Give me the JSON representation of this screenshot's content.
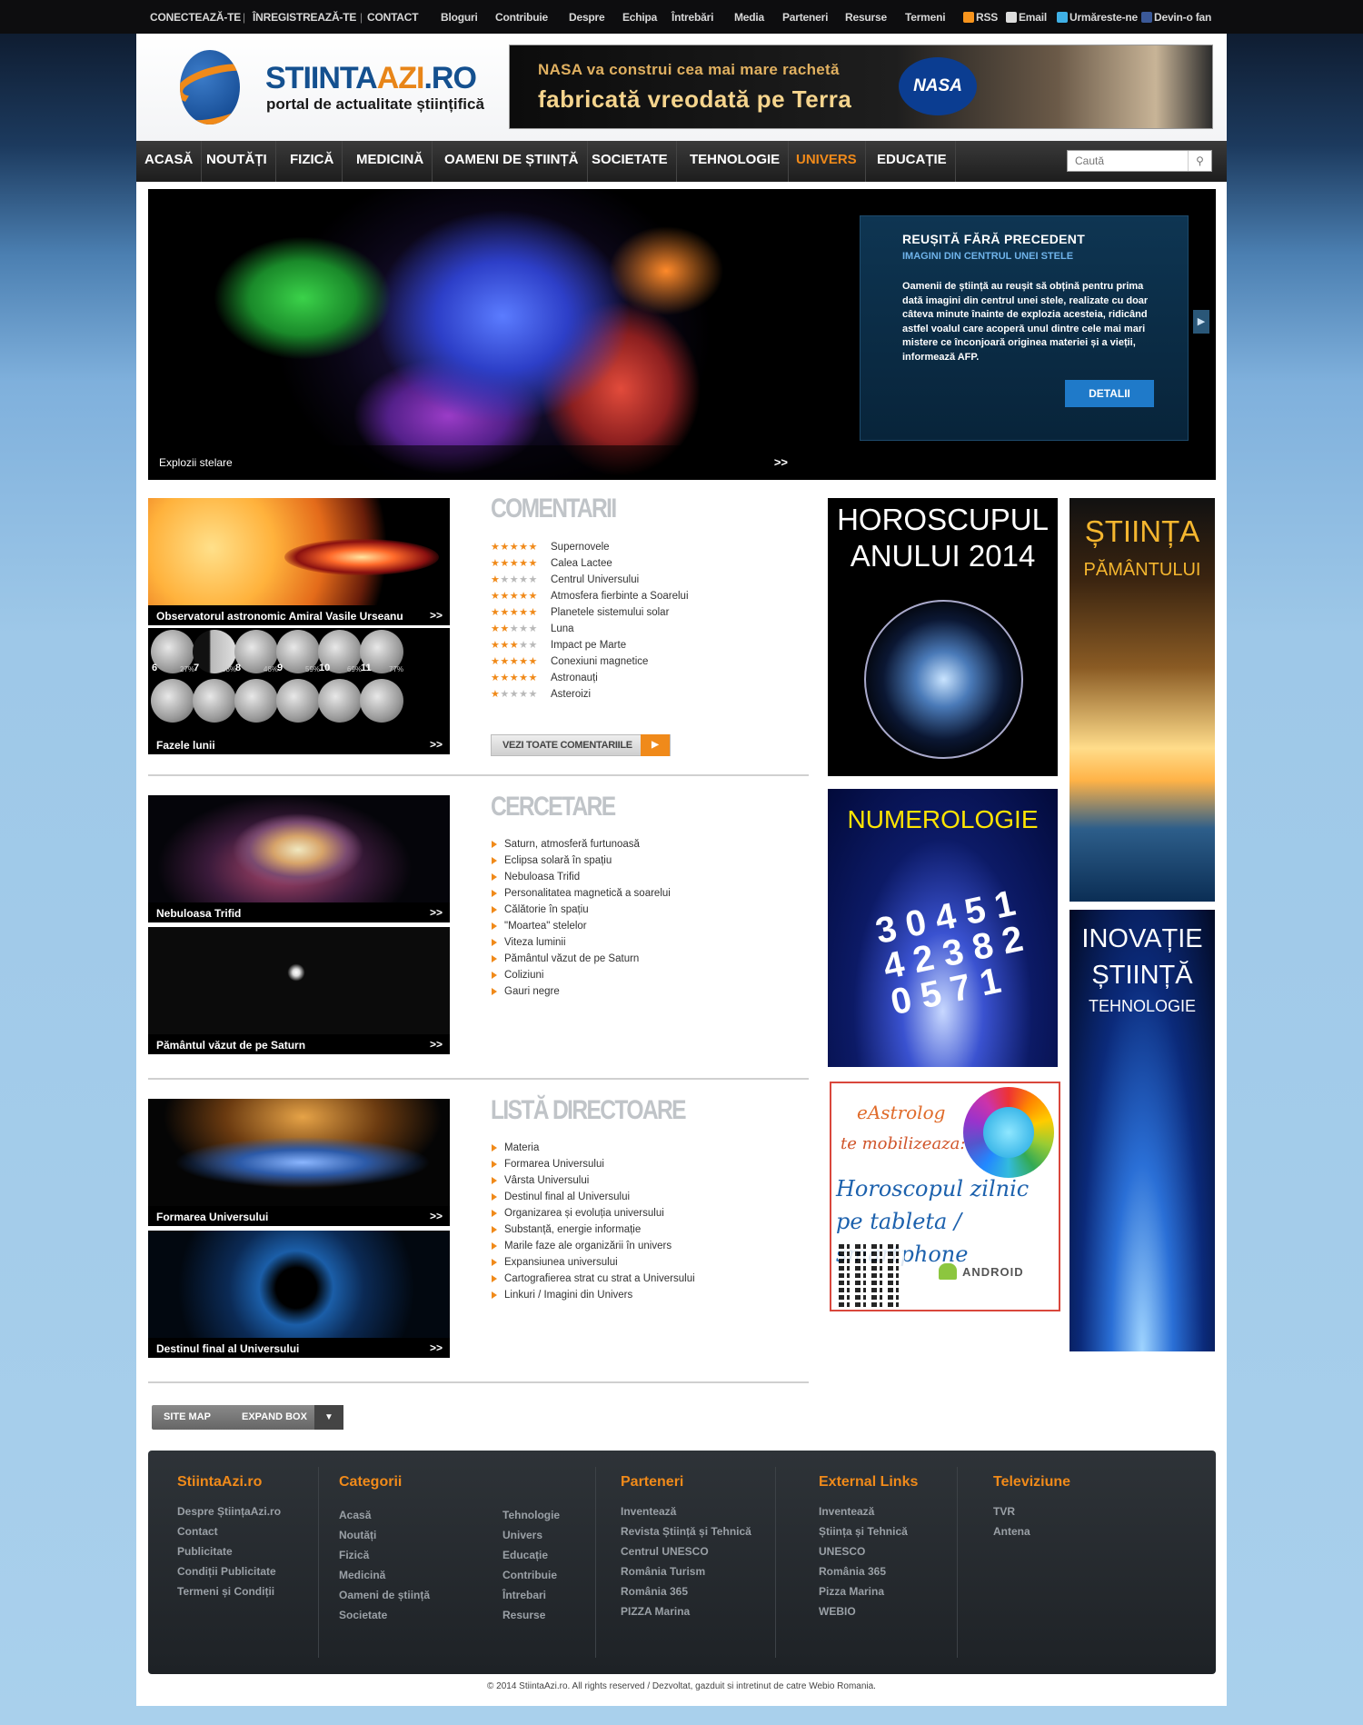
{
  "topbar": {
    "connect": "CONECTEAZĂ-TE",
    "register": "ÎNREGISTREAZĂ-TE",
    "contact": "CONTACT",
    "links": [
      "Bloguri",
      "Contribuie",
      "Despre",
      "Echipa",
      "Întrebări",
      "Media",
      "Parteneri",
      "Resurse",
      "Termeni"
    ],
    "rss": "RSS",
    "email": "Email",
    "follow": "Urmăreste-ne",
    "fan": "Devin-o fan"
  },
  "brand": {
    "name_a": "STIINTA",
    "name_b": "AZI",
    "name_c": ".RO",
    "tagline": "portal de actualitate științifică"
  },
  "banner": {
    "line1": "NASA va construi cea mai mare rachetă",
    "line2": "fabricată vreodată pe Terra",
    "badge": "NASA"
  },
  "nav": {
    "items": [
      "ACASĂ",
      "NOUTĂȚI",
      "FIZICĂ",
      "MEDICINĂ",
      "OAMENI DE ȘTIINȚĂ",
      "SOCIETATE",
      "TEHNOLOGIE",
      "UNIVERS",
      "EDUCAȚIE"
    ],
    "active": "UNIVERS",
    "search_placeholder": "Caută",
    "search_icon": "search-icon"
  },
  "slider": {
    "caption": "Explozii stelare",
    "more": ">>",
    "title": "REUȘITĂ FĂRĂ PRECEDENT",
    "subtitle": "IMAGINI DIN CENTRUL UNEI STELE",
    "text": "Oamenii de știință au reușit să obțină pentru prima dată imagini din centrul unei stele, realizate cu doar câteva minute înainte de explozia acesteia, ridicând astfel voalul care acoperă unul dintre cele mai mari mistere ce înconjoară originea materiei și a vieții, informează AFP.",
    "button": "DETALII",
    "prev": "◀",
    "next": "▶"
  },
  "thumbs": {
    "observatory": "Observatorul astronomic Amiral Vasile Urseanu",
    "moon": "Fazele lunii",
    "trifid": "Nebuloasa Trifid",
    "saturn": "Pământul văzut de pe Saturn",
    "formation": "Formarea Universului",
    "destiny": "Destinul final al Universului",
    "more": ">>"
  },
  "moon_phases": [
    {
      "day": "6",
      "pct": "27%"
    },
    {
      "day": "7",
      "pct": "38%"
    },
    {
      "day": "8",
      "pct": "48%"
    },
    {
      "day": "9",
      "pct": "59%"
    },
    {
      "day": "10",
      "pct": "69%"
    },
    {
      "day": "11",
      "pct": "77%"
    }
  ],
  "comments": {
    "heading": "COMENTARII",
    "button": "VEZI TOATE COMENTARIILE",
    "button_icon": "play-icon",
    "items": [
      {
        "label": "Supernovele",
        "stars": 5
      },
      {
        "label": "Calea Lactee",
        "stars": 5
      },
      {
        "label": "Centrul Universului",
        "stars": 1
      },
      {
        "label": "Atmosfera fierbinte a Soarelui",
        "stars": 5
      },
      {
        "label": "Planetele sistemului solar",
        "stars": 5
      },
      {
        "label": "Luna",
        "stars": 2
      },
      {
        "label": "Impact pe Marte",
        "stars": 3
      },
      {
        "label": "Conexiuni magnetice",
        "stars": 5
      },
      {
        "label": "Astronauți",
        "stars": 5
      },
      {
        "label": "Asteroizi",
        "stars": 1
      }
    ]
  },
  "research": {
    "heading": "CERCETARE",
    "items": [
      "Saturn, atmosferă furtunoasă",
      "Eclipsa solară în spațiu",
      "Nebuloasa Trifid",
      "Personalitatea magnetică a soarelui",
      "Călătorie în spațiu",
      "\"Moartea\" stelelor",
      "Viteza luminii",
      "Pământul văzut de pe Saturn",
      "Coliziuni",
      "Gauri negre"
    ]
  },
  "directory": {
    "heading": "LISTĂ DIRECTOARE",
    "items": [
      "Materia",
      "Formarea Universului",
      "Vârsta Universului",
      "Destinul final al Universului",
      "Organizarea și evoluția universului",
      "Substanță, energie informație",
      "Marile faze ale organizării în univers",
      "Expansiunea universului",
      "Cartografierea strat cu strat a Universului",
      "Linkuri / Imagini din Univers"
    ]
  },
  "ads": {
    "horo_1": "HOROSCUPUL",
    "horo_2": "ANULUI 2014",
    "numer": "NUMEROLOGIE",
    "numer_digits": "3 0 4 5 1 4 2 3 8 2 0 5 7 1",
    "astro_1": "eAstrolog",
    "astro_2": "te mobilizeaza:",
    "astro_3": "Horoscopul zilnic pe tableta / smartphone",
    "astro_android": "ANDROID",
    "stiinta_1": "ȘTIINȚA",
    "stiinta_2": "PĂMÂNTULUI",
    "inov_1": "INOVAȚIE",
    "inov_2": "ȘTIINȚĂ",
    "inov_3": "TEHNOLOGIE"
  },
  "bar": {
    "sitemap": "SITE MAP",
    "expand": "EXPAND BOX",
    "toggle": "▼"
  },
  "footer": {
    "col1": {
      "title": "StiintaAzi.ro",
      "links": [
        "Despre ȘtiințaAzi.ro",
        "Contact",
        "Publicitate",
        "Condiții Publicitate",
        "Termeni și Condiții"
      ]
    },
    "col2": {
      "title": "Categorii",
      "links_a": [
        "Acasă",
        "Noutăți",
        "Fizică",
        "Medicină",
        "Oameni de știință",
        "Societate"
      ],
      "links_b": [
        "Tehnologie",
        "Univers",
        "Educație",
        "Contribuie",
        "Întrebari",
        "Resurse"
      ]
    },
    "col3": {
      "title": "Parteneri",
      "links": [
        "Inventează",
        "Revista Știință și Tehnică",
        "Centrul UNESCO",
        "România Turism",
        "România 365",
        "PIZZA Marina"
      ]
    },
    "col4": {
      "title": "External Links",
      "links": [
        "Inventează",
        "Știința și Tehnică",
        "UNESCO",
        "România 365",
        "Pizza Marina",
        "WEBIO"
      ]
    },
    "col5": {
      "title": "Televiziune",
      "links": [
        "TVR",
        "Antena"
      ]
    },
    "copyright": "© 2014 StiintaAzi.ro. All rights reserved / Dezvoltat, gazduit si intretinut de catre Webio Romania."
  },
  "colors": {
    "accent": "#f08a1a",
    "brand_blue": "#14508f",
    "slider_link": "#1f7ac9"
  }
}
